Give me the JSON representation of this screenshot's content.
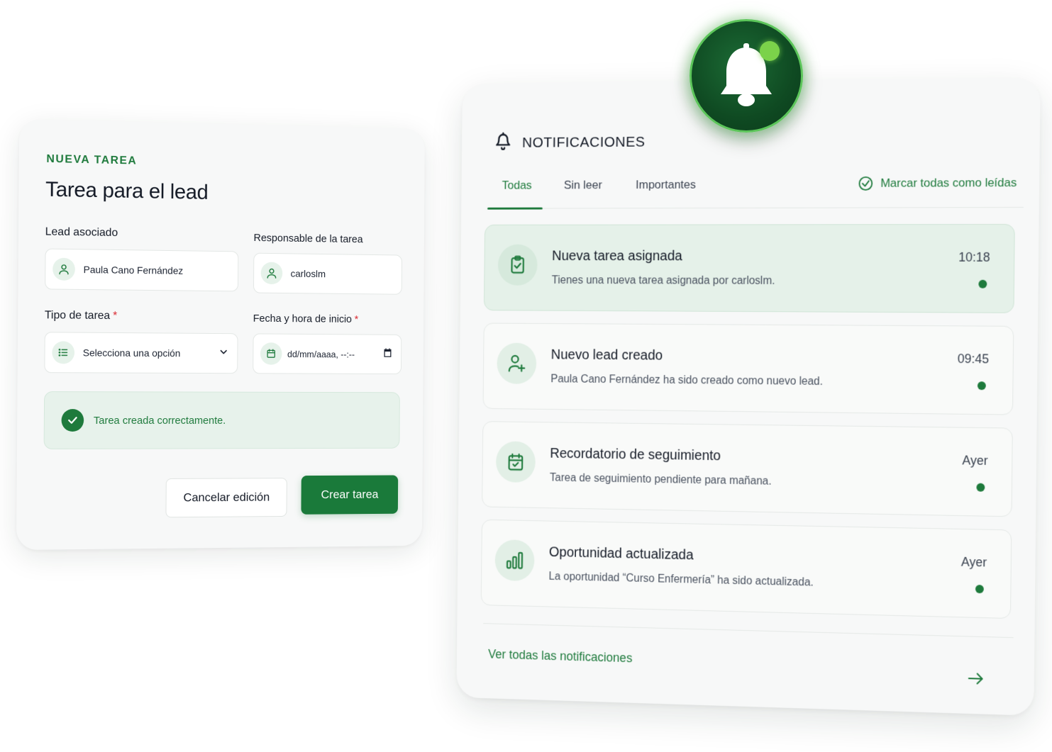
{
  "task_form": {
    "eyebrow": "NUEVA TAREA",
    "title": "Tarea para el lead",
    "lead_label": "Lead asociado",
    "lead_value": "Paula Cano Fernández",
    "owner_label": "Responsable de la tarea",
    "owner_value": "carloslm",
    "type_label": "Tipo de tarea",
    "type_value": "Selecciona una opción",
    "date_label": "Fecha y hora de inicio",
    "date_placeholder": "dd/mm/aaaa, --:--",
    "required_mark": "*",
    "success_message": "Tarea creada correctamente.",
    "cancel_label": "Cancelar edición",
    "create_label": "Crear tarea"
  },
  "notifications": {
    "title": "NOTIFICACIONES",
    "tabs": [
      {
        "label": "Todas",
        "active": true
      },
      {
        "label": "Sin leer",
        "active": false
      },
      {
        "label": "Importantes",
        "active": false
      }
    ],
    "mark_all_label": "Marcar todas como leídas",
    "items": [
      {
        "icon": "clipboard-check-icon",
        "title": "Nueva tarea asignada",
        "description": "Tienes una nueva tarea asignada por carloslm.",
        "time": "10:18",
        "highlighted": true,
        "unread": true
      },
      {
        "icon": "user-plus-icon",
        "title": "Nuevo lead creado",
        "description": "Paula Cano Fernández ha sido creado como nuevo lead.",
        "time": "09:45",
        "highlighted": false,
        "unread": true
      },
      {
        "icon": "calendar-check-icon",
        "title": "Recordatorio de seguimiento",
        "description": "Tarea de seguimiento pendiente para mañana.",
        "time": "Ayer",
        "highlighted": false,
        "unread": true
      },
      {
        "icon": "bar-chart-icon",
        "title": "Oportunidad actualizada",
        "description": "La oportunidad “Curso Enfermería” ha sido actualizada.",
        "time": "Ayer",
        "highlighted": false,
        "unread": true
      }
    ],
    "see_all_label": "Ver todas las notificaciones"
  },
  "colors": {
    "brand_green": "#1e7a3c",
    "badge_dot": "#7bd24a",
    "required": "#d9262e"
  }
}
